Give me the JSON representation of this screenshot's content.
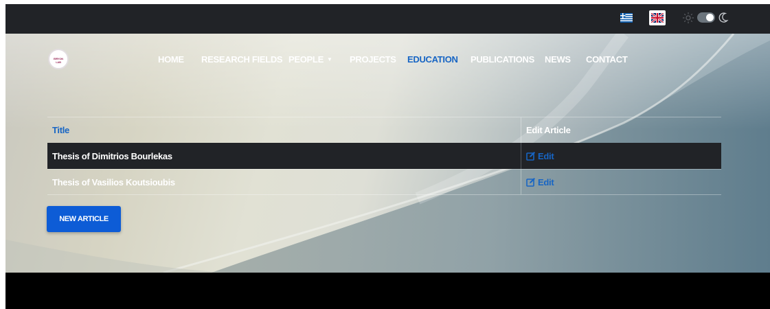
{
  "topbar": {
    "lang_greek_icon": "greek-flag-icon",
    "lang_english_icon": "uk-flag-icon",
    "theme_light_icon": "sun-icon",
    "theme_dark_icon": "moon-icon",
    "theme_toggle_state": "dark"
  },
  "brand": {
    "logo_text": "EIRYON LAB"
  },
  "nav": {
    "items": [
      {
        "label": "HOME"
      },
      {
        "label": "RESEARCH FIELDS"
      },
      {
        "label": "PEOPLE"
      },
      {
        "label": "PROJECTS"
      },
      {
        "label": "EDUCATION"
      },
      {
        "label": "PUBLICATIONS"
      },
      {
        "label": "NEWS"
      },
      {
        "label": "CONTACT"
      }
    ],
    "active": "EDUCATION"
  },
  "table": {
    "headers": {
      "title": "Title",
      "edit": "Edit Article"
    },
    "rows": [
      {
        "title": "Thesis of Dimitrios Bourlekas",
        "edit": "Edit"
      },
      {
        "title": "Thesis of Vasilios Koutsioubis",
        "edit": "Edit"
      }
    ]
  },
  "actions": {
    "new_article": "NEW ARTICLE"
  },
  "colors": {
    "accent": "#1765c4",
    "button": "#0d5cd6",
    "topbar": "#212327",
    "footer": "#000000"
  }
}
